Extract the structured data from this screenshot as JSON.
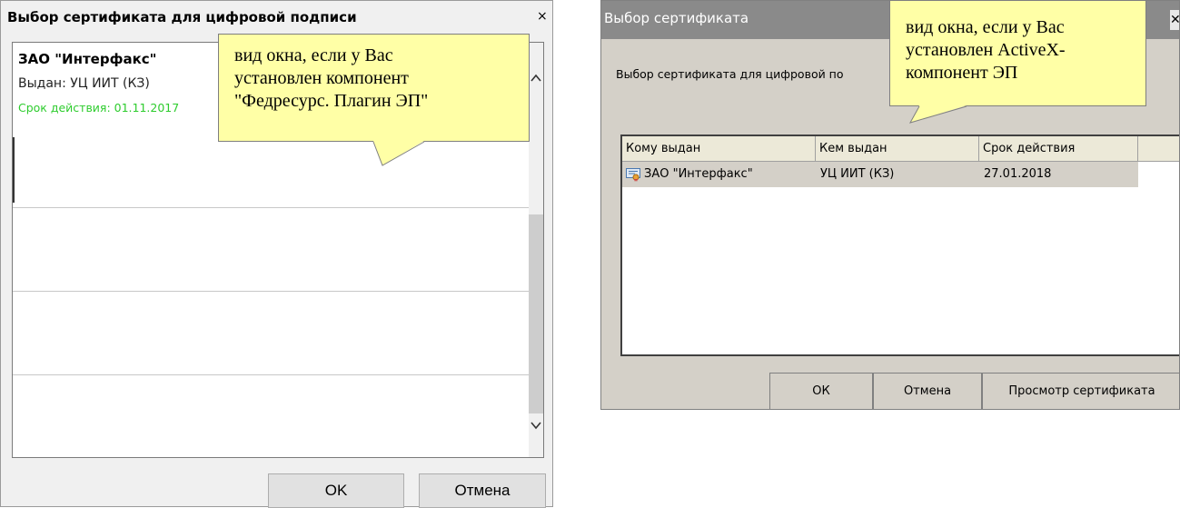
{
  "left_dialog": {
    "title": "Выбор сертификата для цифровой подписи",
    "close_glyph": "×",
    "certificate": {
      "name": "ЗАО \"Интерфакс\"",
      "issuer": "Выдан: УЦ ИИТ (КЗ)",
      "validity": "Срок действия: 01.11.2017",
      "validity_color": "#2ecc2e"
    },
    "scroll_up_glyph": "⌃",
    "scroll_down_glyph": "⌄",
    "ok_label": "OK",
    "cancel_label": "Отмена"
  },
  "callout_left": {
    "text_lines": [
      "вид окна, если у Вас",
      "установлен компонент",
      "\"Федресурс. Плагин ЭП\""
    ],
    "fill_color": "#ffffa6"
  },
  "callout_right": {
    "text_lines": [
      "вид окна, если у Вас",
      "установлен ActiveX-",
      "компонент ЭП"
    ],
    "fill_color": "#ffffa6"
  },
  "right_dialog": {
    "title": "Выбор сертификата",
    "close_glyph": "✕",
    "subtitle": "Выбор сертификата для цифровой по",
    "columns": [
      "Кому выдан",
      "Кем выдан",
      "Срок действия",
      ""
    ],
    "rows": [
      {
        "icon": "certificate-icon",
        "issued_to": "ЗАО \"Интерфакс\"",
        "issued_by": "УЦ ИИТ (КЗ)",
        "expires": "27.01.2018"
      }
    ],
    "ok_label": "ОК",
    "cancel_label": "Отмена",
    "view_label": "Просмотр сертификата"
  }
}
